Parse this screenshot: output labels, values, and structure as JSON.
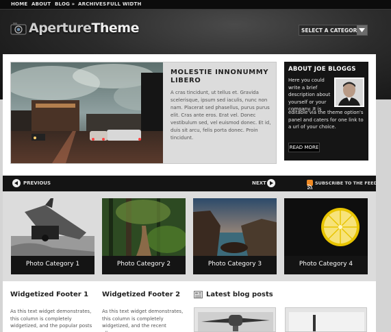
{
  "topnav": {
    "items": [
      "HOME",
      "ABOUT",
      "BLOG »",
      "ARCHIVES",
      "FULL WIDTH"
    ]
  },
  "logo": {
    "part1": "Aperture",
    "part2": "Theme"
  },
  "category_select": {
    "label": "SELECT A CATEGORY",
    "icon": "chevron-down-icon"
  },
  "feature": {
    "title": "MOLESTIE INNONUMMY LIBERO",
    "text": "A cras tincidunt, ut tellus et. Gravida scelerisque, ipsum sed iaculis, nunc non nam. Placerat sed phasellus, purus purus elit. Cras ante eros. Erat vel. Donec vestibulum sed, vel euismod donec. Et id, duis sit arcu, felis porta donec. Proin tincidunt."
  },
  "about": {
    "title": "ABOUT JOE BLOGGS",
    "text1": "Here you could write a brief description about yourself or your company. It is",
    "text2": "editable via the theme option's panel and caters for one link to a url of your choice.",
    "button": "READ MORE"
  },
  "nav": {
    "previous": "PREVIOUS",
    "next": "NEXT",
    "subscribe": "SUBSCRIBE TO THE FEED"
  },
  "gallery": [
    {
      "caption": "Photo Category 1"
    },
    {
      "caption": "Photo Category 2"
    },
    {
      "caption": "Photo Category 3"
    },
    {
      "caption": "Photo Category 4"
    }
  ],
  "footer": {
    "col1": {
      "title": "Widgetized Footer 1",
      "text": "As this text widget demonstrates, this column is completely widgetized, and the popular posts"
    },
    "col2": {
      "title": "Widgetized Footer 2",
      "text": "As this text widget demonstrates, this column is completely widgetized, and the recent albums"
    },
    "blog": {
      "title": "Latest blog posts"
    }
  },
  "colors": {
    "header_dark": "#1a1a1a",
    "panel_grey": "#dcdcdc",
    "rss_orange": "#f08a24"
  }
}
